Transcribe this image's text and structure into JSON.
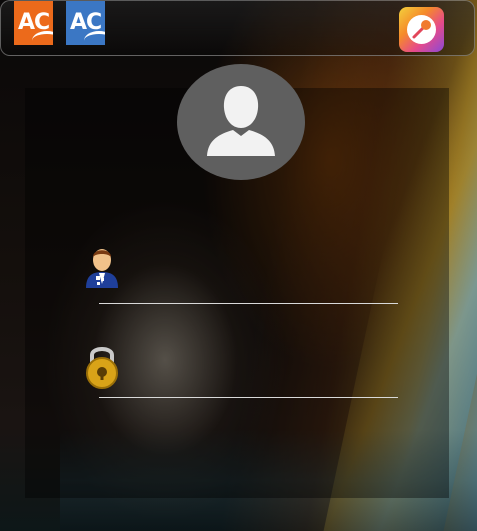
{
  "taskbar": {
    "apps": [
      {
        "label": "AC",
        "icon": "orange-app-icon",
        "color": "#ec6a1b"
      },
      {
        "label": "AC",
        "icon": "blue-app-icon",
        "color": "#3b77c4"
      }
    ],
    "right_app": {
      "icon": "microphone-app-icon"
    }
  },
  "login": {
    "avatar_icon": "user-silhouette-icon",
    "username": {
      "icon": "user-icon",
      "value": "",
      "placeholder": ""
    },
    "password": {
      "icon": "padlock-icon",
      "value": "",
      "placeholder": ""
    }
  }
}
